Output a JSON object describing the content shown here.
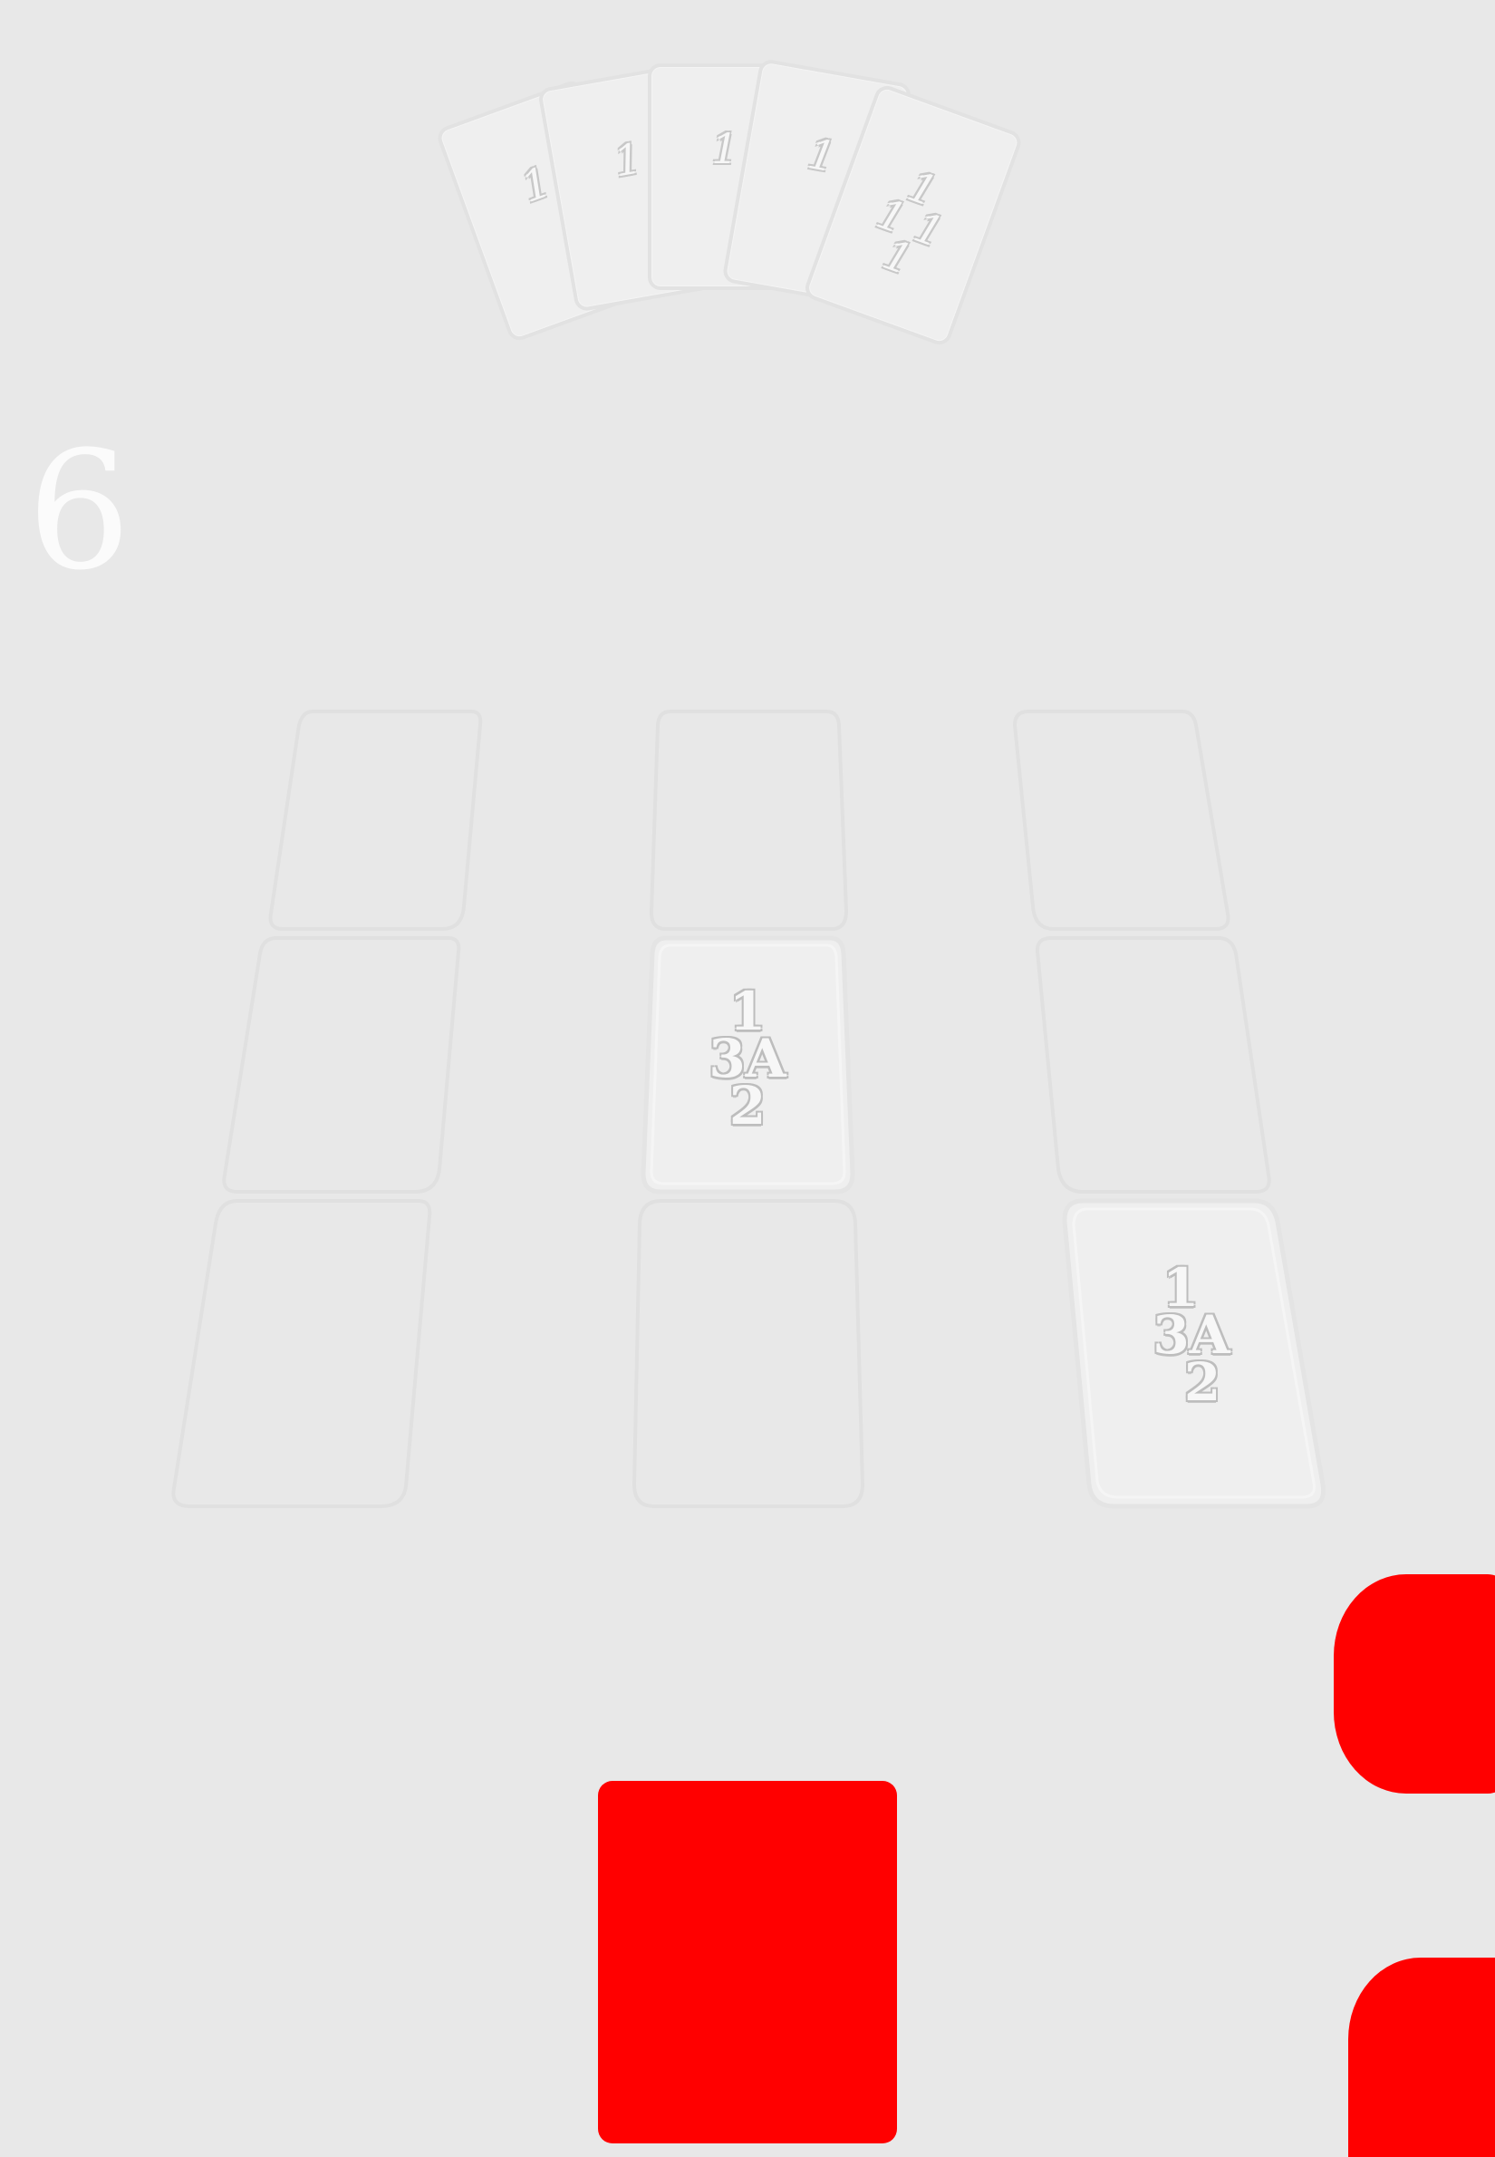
{
  "opponent_hand": {
    "cards": [
      {
        "face": "1"
      },
      {
        "face": "1"
      },
      {
        "face": "1"
      },
      {
        "face": "1"
      },
      {
        "face": "1\n1 1\n1"
      }
    ]
  },
  "counter": {
    "value": "6"
  },
  "board": {
    "card_label": {
      "top": "1",
      "middle": "3A",
      "bottom": "2"
    }
  },
  "colors": {
    "background": "#e8e8e8",
    "accent": "#ff0000",
    "card_fill": "#efefef",
    "slot_stroke": "#e2e2e2"
  },
  "icons": {
    "deck": "card-back",
    "action_top": "red-button",
    "action_bottom": "red-button"
  }
}
